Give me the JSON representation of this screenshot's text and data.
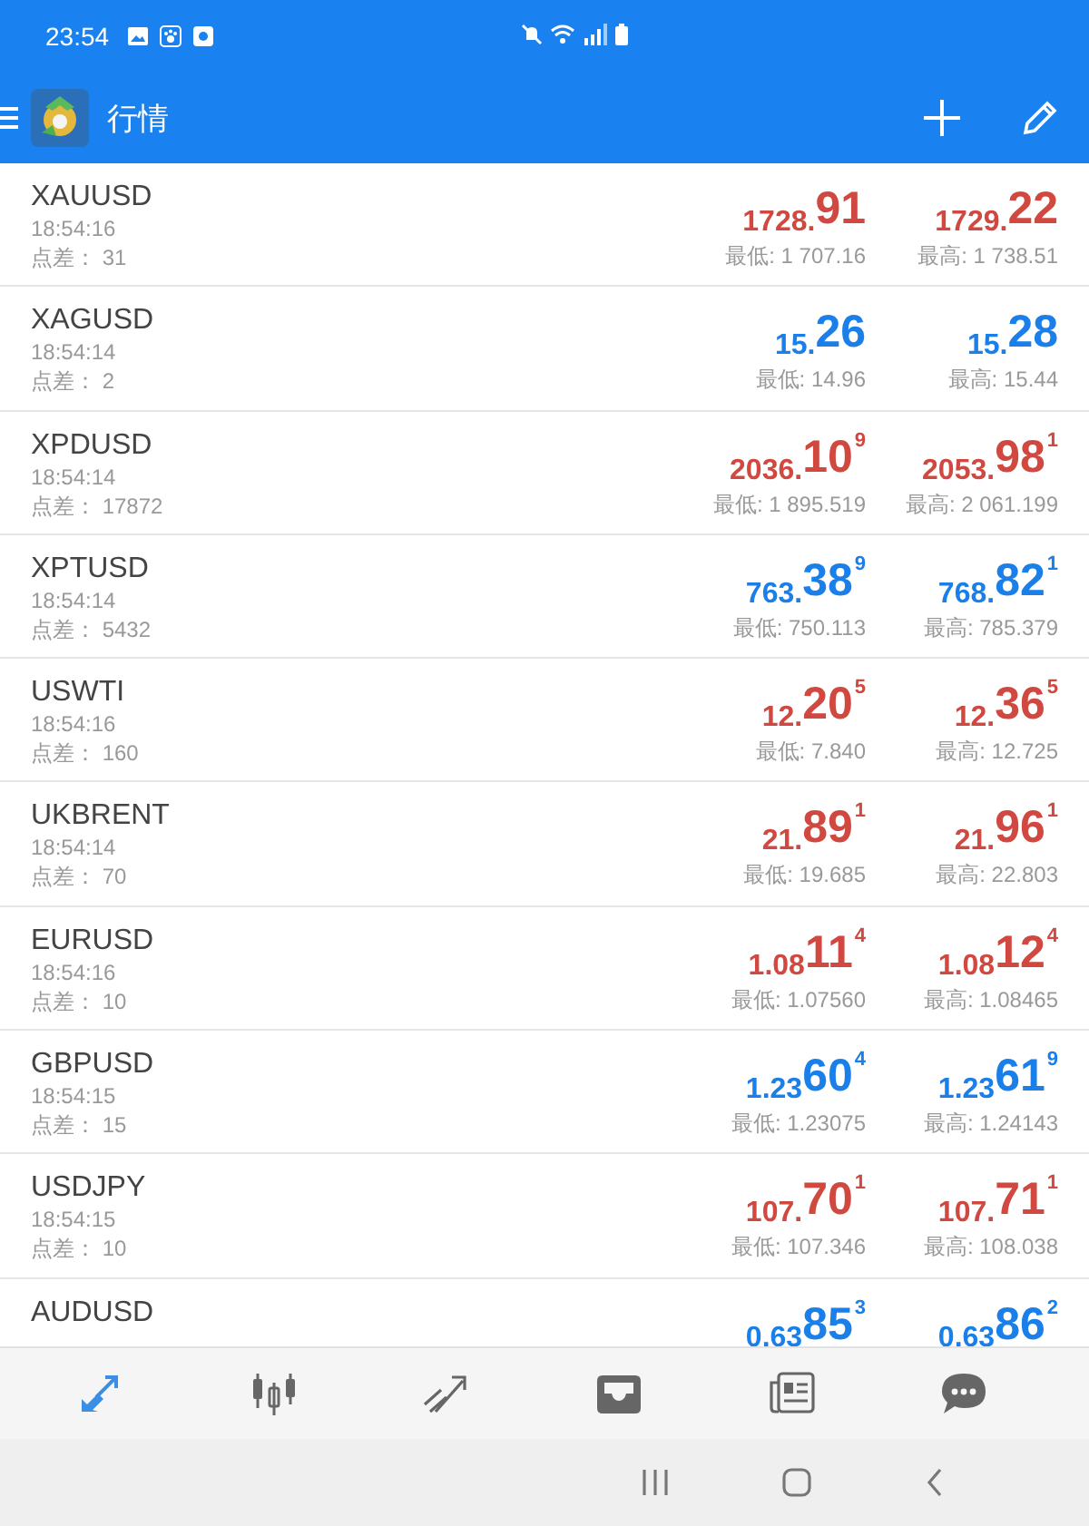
{
  "status_bar": {
    "time": "23:54"
  },
  "header": {
    "title": "行情"
  },
  "quotes": [
    {
      "symbol": "XAUUSD",
      "time": "18:54:16",
      "spread": "点差： 31",
      "color": "#d0483f",
      "bid": {
        "prefix": "1728.",
        "big": "91"
      },
      "ask": {
        "prefix": "1729.",
        "big": "22"
      },
      "low": "最低: 1 707.16",
      "high": "最高: 1 738.51"
    },
    {
      "symbol": "XAGUSD",
      "time": "18:54:14",
      "spread": "点差： 2",
      "color": "#1a7fe8",
      "bid": {
        "prefix": "15.",
        "big": "26"
      },
      "ask": {
        "prefix": "15.",
        "big": "28"
      },
      "low": "最低: 14.96",
      "high": "最高: 15.44"
    },
    {
      "symbol": "XPDUSD",
      "time": "18:54:14",
      "spread": "点差： 17872",
      "color": "#d0483f",
      "bid": {
        "prefix": "2036.",
        "big": "10",
        "sup": "9"
      },
      "ask": {
        "prefix": "2053.",
        "big": "98",
        "sup": "1"
      },
      "low": "最低: 1 895.519",
      "high": "最高: 2 061.199"
    },
    {
      "symbol": "XPTUSD",
      "time": "18:54:14",
      "spread": "点差： 5432",
      "color": "#1a7fe8",
      "bid": {
        "prefix": "763.",
        "big": "38",
        "sup": "9"
      },
      "ask": {
        "prefix": "768.",
        "big": "82",
        "sup": "1"
      },
      "low": "最低: 750.113",
      "high": "最高: 785.379"
    },
    {
      "symbol": "USWTI",
      "time": "18:54:16",
      "spread": "点差： 160",
      "color": "#d0483f",
      "bid": {
        "prefix": "12.",
        "big": "20",
        "sup": "5"
      },
      "ask": {
        "prefix": "12.",
        "big": "36",
        "sup": "5"
      },
      "low": "最低: 7.840",
      "high": "最高: 12.725"
    },
    {
      "symbol": "UKBRENT",
      "time": "18:54:14",
      "spread": "点差： 70",
      "color": "#d0483f",
      "bid": {
        "prefix": "21.",
        "big": "89",
        "sup": "1"
      },
      "ask": {
        "prefix": "21.",
        "big": "96",
        "sup": "1"
      },
      "low": "最低: 19.685",
      "high": "最高: 22.803"
    },
    {
      "symbol": "EURUSD",
      "time": "18:54:16",
      "spread": "点差： 10",
      "color": "#d0483f",
      "bid": {
        "prefix": "1.08",
        "big": "11",
        "sup": "4"
      },
      "ask": {
        "prefix": "1.08",
        "big": "12",
        "sup": "4"
      },
      "low": "最低: 1.07560",
      "high": "最高: 1.08465"
    },
    {
      "symbol": "GBPUSD",
      "time": "18:54:15",
      "spread": "点差： 15",
      "color": "#1a7fe8",
      "bid": {
        "prefix": "1.23",
        "big": "60",
        "sup": "4"
      },
      "ask": {
        "prefix": "1.23",
        "big": "61",
        "sup": "9"
      },
      "low": "最低: 1.23075",
      "high": "最高: 1.24143"
    },
    {
      "symbol": "USDJPY",
      "time": "18:54:15",
      "spread": "点差： 10",
      "color": "#d0483f",
      "bid": {
        "prefix": "107.",
        "big": "70",
        "sup": "1"
      },
      "ask": {
        "prefix": "107.",
        "big": "71",
        "sup": "1"
      },
      "low": "最低: 107.346",
      "high": "最高: 108.038"
    },
    {
      "symbol": "AUDUSD",
      "color": "#1a7fe8",
      "bid": {
        "prefix": "0.63",
        "big": "85",
        "sup": "3"
      },
      "ask": {
        "prefix": "0.63",
        "big": "86",
        "sup": "2"
      }
    }
  ],
  "tabs": [
    {
      "kind": "quotes",
      "selected": true
    },
    {
      "kind": "chart",
      "selected": false
    },
    {
      "kind": "trade",
      "selected": false
    },
    {
      "kind": "history",
      "selected": false
    },
    {
      "kind": "news",
      "selected": false
    },
    {
      "kind": "chat",
      "selected": false
    }
  ]
}
